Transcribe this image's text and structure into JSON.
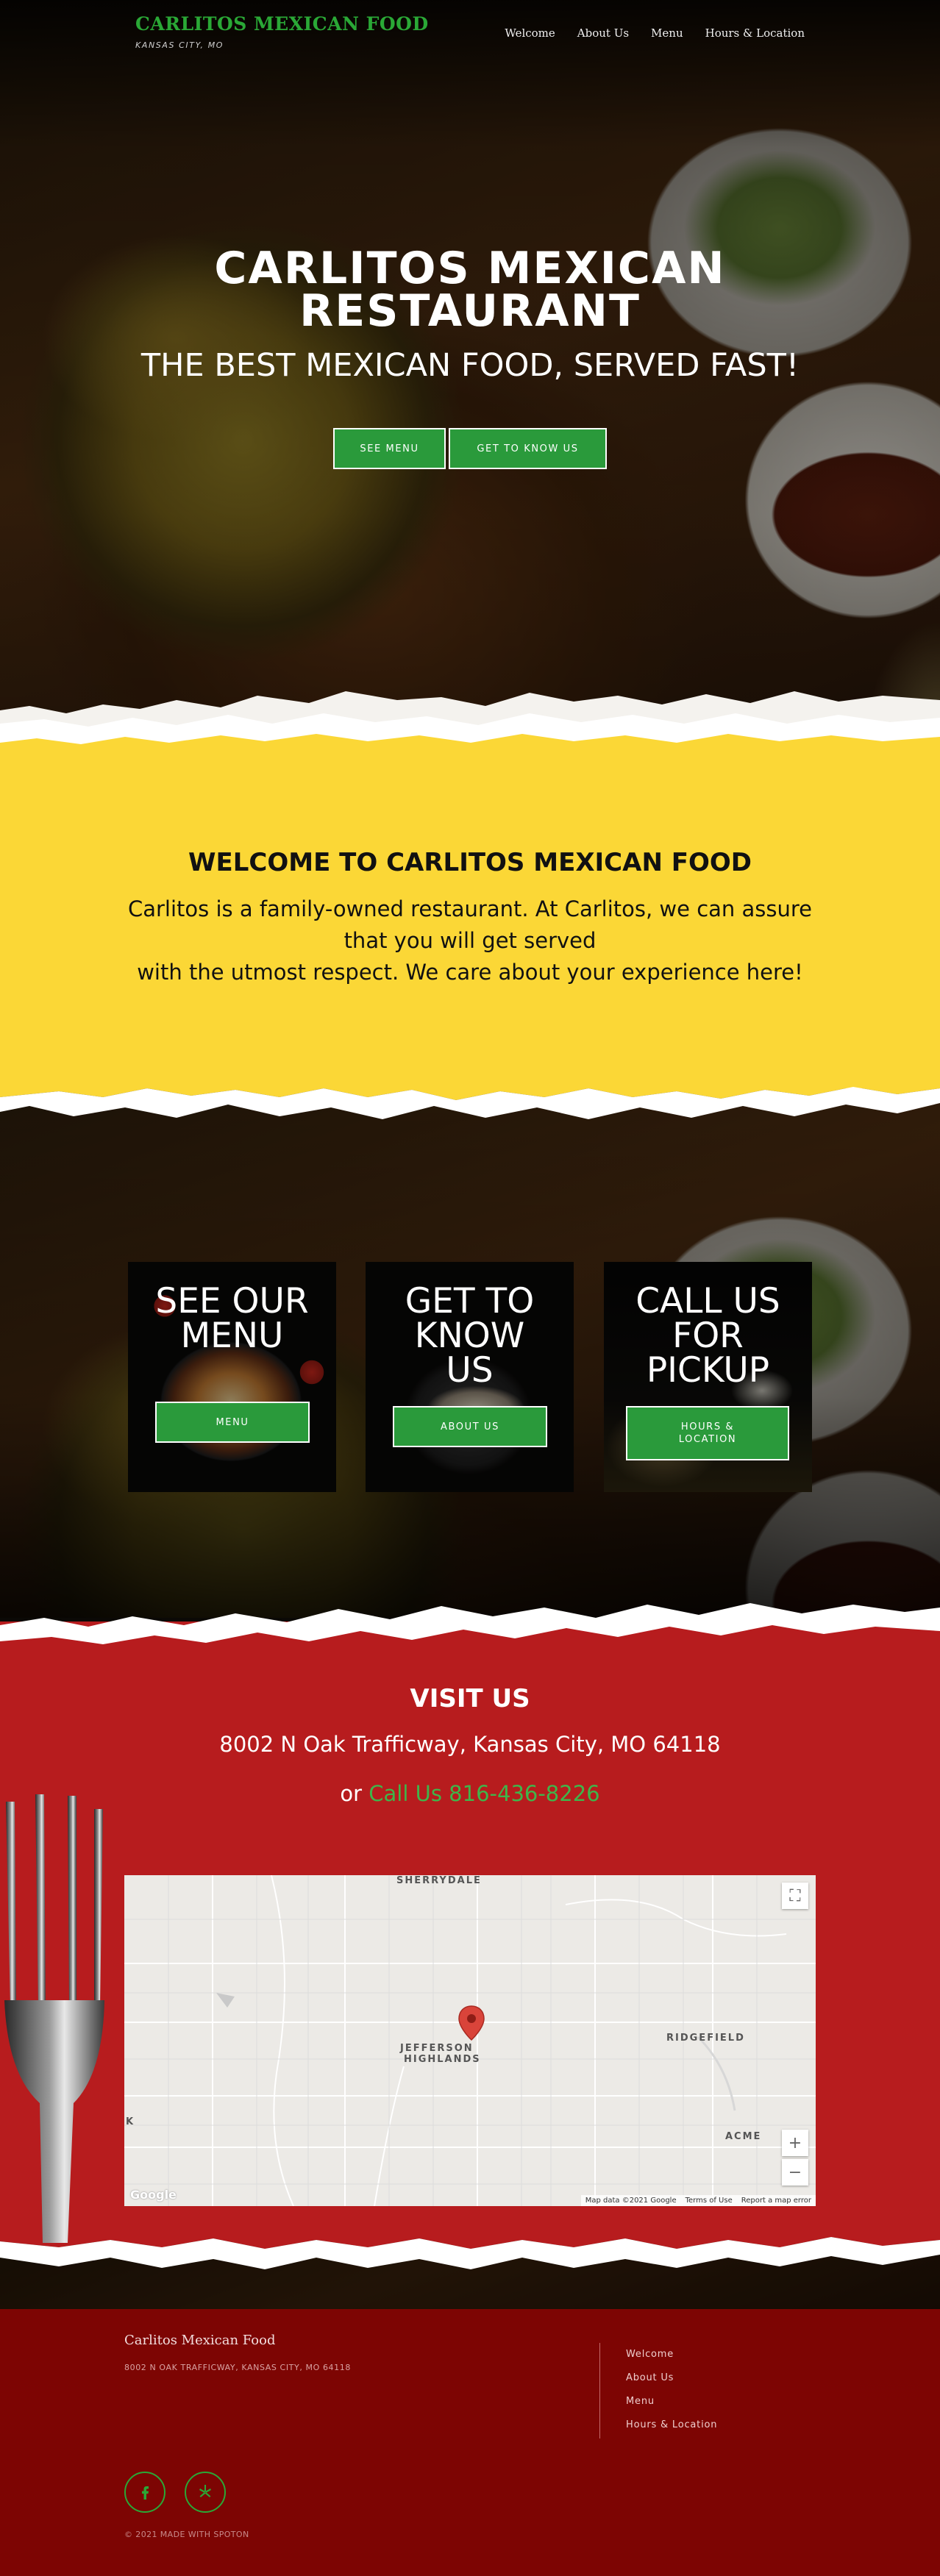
{
  "header": {
    "brand_name": "CARLITOS MEXICAN FOOD",
    "brand_tagline": "KANSAS CITY, MO",
    "nav": [
      "Welcome",
      "About Us",
      "Menu",
      "Hours & Location"
    ]
  },
  "hero": {
    "title_line1": "CARLITOS MEXICAN",
    "title_line2": "RESTAURANT",
    "subtitle": "THE BEST MEXICAN FOOD, SERVED FAST!",
    "buttons": [
      "SEE MENU",
      "GET TO KNOW US"
    ]
  },
  "welcome": {
    "title": "WELCOME TO CARLITOS MEXICAN FOOD",
    "lines": [
      "Carlitos is a family-owned restaurant. At Carlitos, we can assure",
      "that you will get served",
      "with the utmost respect. We care about your experience here!"
    ]
  },
  "cards": [
    {
      "title_lines": [
        "SEE OUR",
        "MENU"
      ],
      "button_lines": [
        "MENU"
      ]
    },
    {
      "title_lines": [
        "GET TO",
        "KNOW",
        "US"
      ],
      "button_lines": [
        "ABOUT US"
      ]
    },
    {
      "title_lines": [
        "CALL US",
        "FOR",
        "PICKUP"
      ],
      "button_lines": [
        "HOURS &",
        "LOCATION"
      ]
    }
  ],
  "visit": {
    "title": "VISIT US",
    "address": "8002 N Oak Trafficway, Kansas City, MO 64118",
    "call_prefix": "or",
    "call_link": "Call Us 816-436-8226"
  },
  "map": {
    "labels": {
      "sherrydale": "SHERRYDALE",
      "jefferson1": "JEFFERSON",
      "jefferson2": "HIGHLANDS",
      "ridgefield": "RIDGEFIELD",
      "acme": "ACME",
      "k": "K"
    },
    "attribution": [
      "Map data ©2021 Google",
      "Terms of Use",
      "Report a map error"
    ],
    "logo": "Google",
    "zoom_in": "+",
    "zoom_out": "−",
    "pin_color": "#d9443a"
  },
  "footer": {
    "name": "Carlitos Mexican Food",
    "address": "8002 N OAK TRAFFICWAY, KANSAS CITY, MO 64118",
    "links": [
      "Welcome",
      "About Us",
      "Menu",
      "Hours & Location"
    ],
    "social": [
      "facebook-icon",
      "yelp-icon"
    ],
    "copyright": "© 2021 MADE WITH SPOTON"
  },
  "colors": {
    "accent_green": "#2aa836",
    "button_green": "#2a9a3b",
    "welcome_yellow": "#fbd736",
    "visit_red": "#b71c1e",
    "footer_red": "#7d0503"
  }
}
